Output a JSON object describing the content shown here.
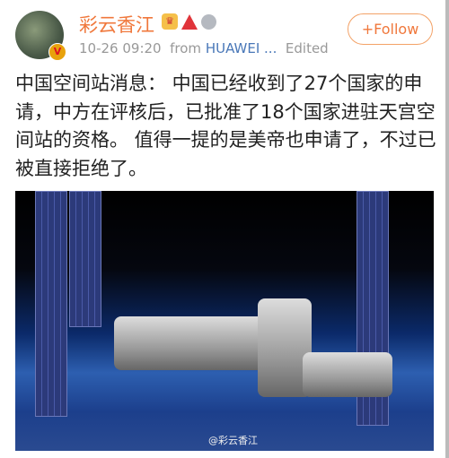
{
  "post": {
    "author": "彩云香江",
    "timestamp": "10-26 09:20",
    "from_label": "from",
    "source": "HUAWEI ...",
    "edited_label": "Edited",
    "follow_label": "+Follow",
    "verified_badge": "V",
    "icons": [
      "crown-badge-icon",
      "red-a-badge-icon",
      "silver-medal-icon"
    ],
    "text": "中国空间站消息： 中国已经收到了27个国家的申请，中方在评核后，已批准了18个国家进驻天宫空间站的资格。 值得一提的是美帝也申请了，不过已被直接拒绝了。",
    "image_watermark": "@彩云香江"
  },
  "colors": {
    "accent": "#f0783c",
    "link": "#4a78b8",
    "meta": "#999999"
  }
}
